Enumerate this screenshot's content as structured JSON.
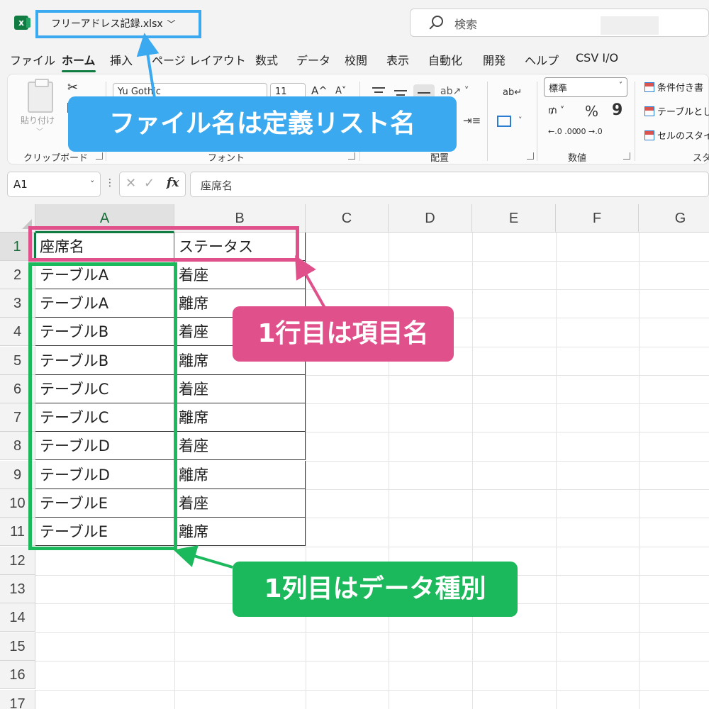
{
  "titlebar": {
    "app_icon_letter": "x",
    "file_name": "フリーアドレス記録.xlsx",
    "file_caret": "﹀",
    "search_placeholder": "検索"
  },
  "menu": {
    "tabs": [
      {
        "label": "ファイル"
      },
      {
        "label": "ホーム",
        "active": true
      },
      {
        "label": "挿入"
      },
      {
        "label": "ページ レイアウト"
      },
      {
        "label": "数式"
      },
      {
        "label": "データ"
      },
      {
        "label": "校閲"
      },
      {
        "label": "表示"
      },
      {
        "label": "自動化"
      },
      {
        "label": "開発"
      },
      {
        "label": "ヘルプ"
      },
      {
        "label": "CSV I/O"
      }
    ]
  },
  "ribbon": {
    "clipboard": {
      "paste_label": "貼り付け",
      "group_label": "クリップボード"
    },
    "font": {
      "font_name": "Yu Gothic",
      "font_size": "11",
      "grow": "A^",
      "shrink": "A˅",
      "group_label": "フォント"
    },
    "alignment": {
      "group_label": "配置",
      "wrap": "ab↵"
    },
    "number": {
      "format": "標準",
      "group_label": "数値",
      "currency": "₥ ˅",
      "percent": "%",
      "comma": "9",
      "inc_decimal": "←.0 .00",
      "dec_decimal": ".00 →.0"
    },
    "styles": {
      "items": [
        "条件付き書",
        "テーブルとし",
        "セルのスタイ"
      ],
      "group_label": "スタ"
    }
  },
  "formula_bar": {
    "name_box": "A1",
    "fx": "fx",
    "content": "座席名"
  },
  "grid": {
    "columns": [
      "A",
      "B",
      "C",
      "D",
      "E",
      "F",
      "G"
    ],
    "rows": [
      "1",
      "2",
      "3",
      "4",
      "5",
      "6",
      "7",
      "8",
      "9",
      "10",
      "11",
      "12",
      "13",
      "14",
      "15",
      "16",
      "17"
    ],
    "table": [
      [
        "座席名",
        "ステータス"
      ],
      [
        "テーブルA",
        "着座"
      ],
      [
        "テーブルA",
        "離席"
      ],
      [
        "テーブルB",
        "着座"
      ],
      [
        "テーブルB",
        "離席"
      ],
      [
        "テーブルC",
        "着座"
      ],
      [
        "テーブルC",
        "離席"
      ],
      [
        "テーブルD",
        "着座"
      ],
      [
        "テーブルD",
        "離席"
      ],
      [
        "テーブルE",
        "着座"
      ],
      [
        "テーブルE",
        "離席"
      ]
    ]
  },
  "annotations": {
    "file_callout": "ファイル名は定義リスト名",
    "row_callout": "1行目は項目名",
    "col_callout": "1列目はデータ種別",
    "colors": {
      "blue": "#3aa9ef",
      "pink": "#e0508a",
      "green": "#1cb85c"
    }
  }
}
